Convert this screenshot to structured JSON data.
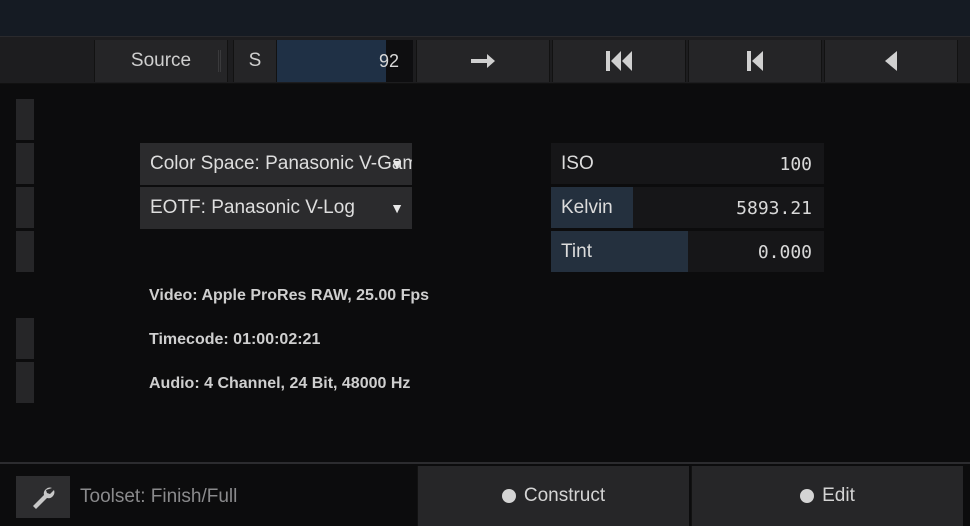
{
  "toolbar": {
    "source_label": "Source",
    "s_label": "S",
    "value": "92",
    "value_fraction": 0.8,
    "icons": [
      "arrow-right-icon",
      "skip-to-start-icon",
      "step-back-icon",
      "play-reverse-icon"
    ]
  },
  "left": {
    "color_space": "Color Space: Panasonic V-Gamut",
    "eotf": "EOTF: Panasonic V-Log",
    "video": "Video: Apple ProRes RAW, 25.00 Fps",
    "timecode": "Timecode: 01:00:02:21",
    "audio": "Audio: 4 Channel, 24 Bit, 48000 Hz"
  },
  "params": [
    {
      "label": "ISO",
      "value": "100",
      "fill": 0.0
    },
    {
      "label": "Kelvin",
      "value": "5893.21",
      "fill": 0.3
    },
    {
      "label": "Tint",
      "value": "0.000",
      "fill": 0.5
    }
  ],
  "footer": {
    "toolset": "Toolset: Finish/Full",
    "construct": "Construct",
    "edit": "Edit"
  },
  "colors": {
    "accent_fill": "#1f3045",
    "background": "#0c0c0d"
  }
}
